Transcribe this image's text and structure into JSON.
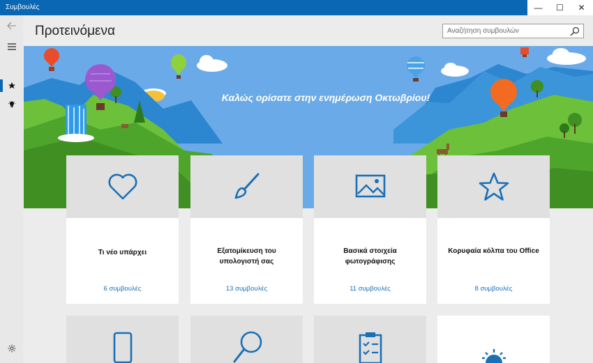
{
  "window": {
    "title": "Συμβουλές"
  },
  "window_controls": {
    "minimize": "—",
    "maximize": "☐",
    "close": "✕"
  },
  "header": {
    "title": "Προτεινόμενα"
  },
  "search": {
    "placeholder": "Αναζήτηση συμβουλών"
  },
  "banner": {
    "text": "Καλώς ορίσατε στην ενημέρωση Οκτωβρίου!"
  },
  "cards": [
    {
      "title": "Τι νέο υπάρχει",
      "count": "6 συμβουλές",
      "icon": "heart-icon"
    },
    {
      "title": "Εξατομίκευση του υπολογιστή σας",
      "count": "13 συμβουλές",
      "icon": "brush-icon"
    },
    {
      "title": "Βασικά στοιχεία φωτογράφισης",
      "count": "11 συμβουλές",
      "icon": "picture-icon"
    },
    {
      "title": "Κορυφαία κόλπα του Office",
      "count": "8 συμβουλές",
      "icon": "star-icon"
    }
  ],
  "cards_row2_icons": [
    "phone-icon",
    "magnifier-icon",
    "clipboard-icon",
    "sunrise-icon"
  ],
  "colors": {
    "accent": "#0a67b4",
    "link": "#1a6fb5",
    "sky": "#6aaae8",
    "grass": "#5bb12f"
  }
}
